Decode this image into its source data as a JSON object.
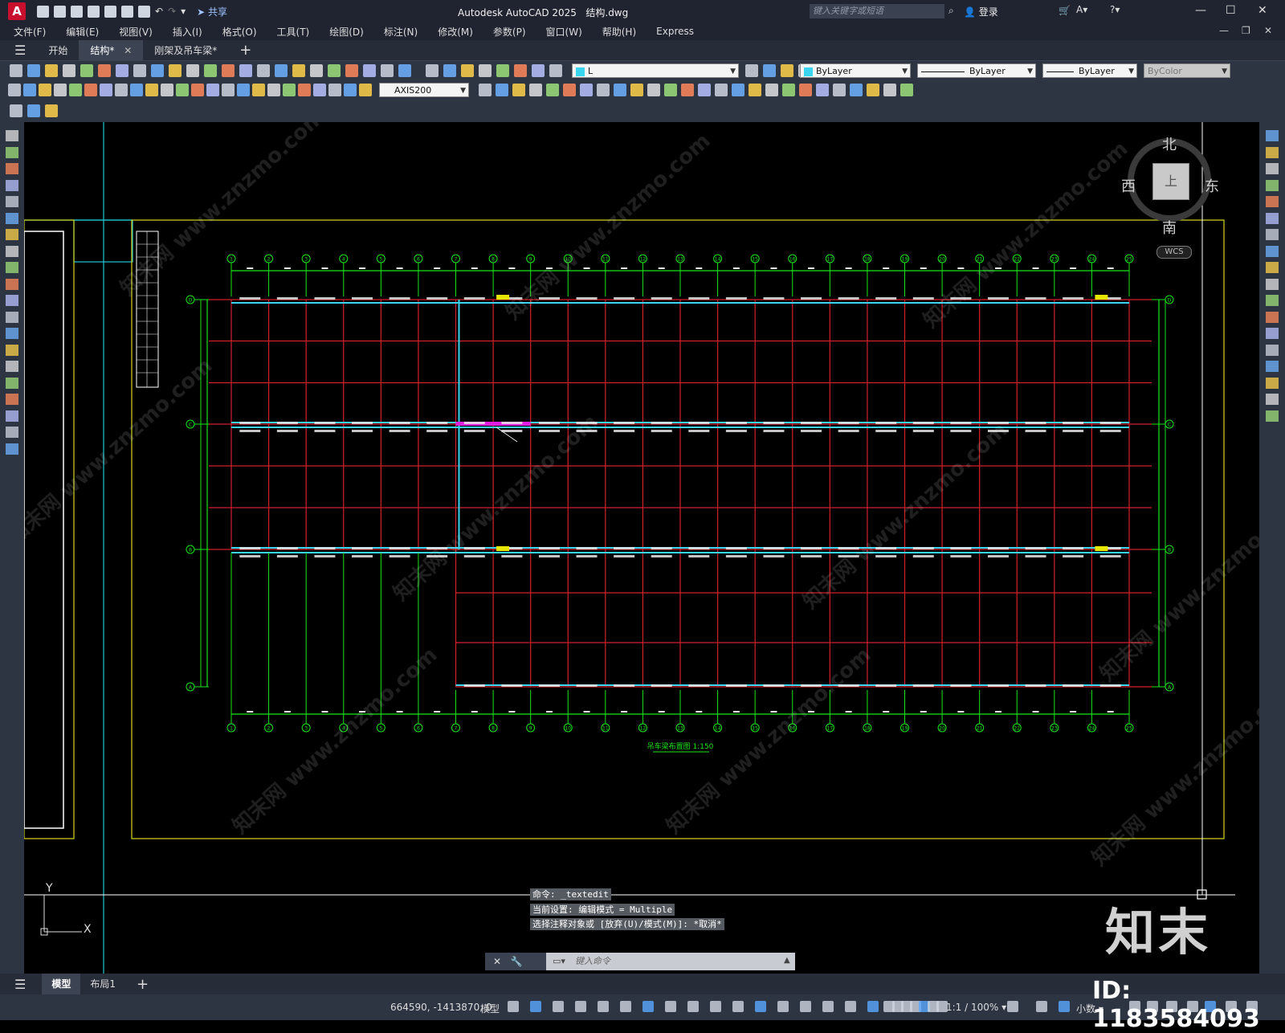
{
  "app": {
    "logo": "A",
    "title": "Autodesk AutoCAD 2025",
    "document": "结构.dwg",
    "share_label": "共享",
    "search_placeholder": "键入关键字或短语",
    "login_label": "登录"
  },
  "menu": [
    "文件(F)",
    "编辑(E)",
    "视图(V)",
    "插入(I)",
    "格式(O)",
    "工具(T)",
    "绘图(D)",
    "标注(N)",
    "修改(M)",
    "参数(P)",
    "窗口(W)",
    "帮助(H)",
    "Express"
  ],
  "doc_tabs": [
    "开始",
    "结构*",
    "刚架及吊车梁*"
  ],
  "toolbar": {
    "layer_name": "L",
    "color": "ByLayer",
    "linetype": "ByLayer",
    "lineweight": "ByLayer",
    "plotstyle": "ByColor",
    "dimstyle": "AXIS200"
  },
  "viewcube": {
    "north": "北",
    "south": "南",
    "east": "东",
    "west": "西",
    "face": "上",
    "wcs": "WCS"
  },
  "command_history": [
    "命令: _textedit",
    "当前设置: 编辑模式 = Multiple",
    "选择注释对象或 [放弃(U)/模式(M)]: *取消*"
  ],
  "command_placeholder": "键入命令",
  "drawing_title": "吊车梁布置图 1:150",
  "axis_labels_top": [
    "1",
    "2",
    "3",
    "4",
    "5",
    "6",
    "7",
    "8",
    "9",
    "10",
    "11",
    "12",
    "13",
    "14",
    "15",
    "16",
    "17",
    "18",
    "19",
    "20",
    "21",
    "22",
    "23",
    "24",
    "25"
  ],
  "axis_labels_side": [
    "D",
    "C",
    "B",
    "A"
  ],
  "ucs": {
    "x": "X",
    "y": "Y"
  },
  "layout_tabs": [
    "模型",
    "布局1"
  ],
  "status": {
    "coordinates": "664590, -1413870, 0",
    "mode": "模型",
    "scale": "1:1 / 100%",
    "units": "小数"
  },
  "watermark": {
    "brand": "知末",
    "id": "ID: 1183584093",
    "text": "知末网 www.znzmo.com"
  },
  "colors": {
    "grid_red": "#d4202a",
    "axis_green": "#19e619",
    "beam_cyan": "#3ad6f0",
    "frame_yellow": "#d6d620",
    "highlight_magenta": "#e020e0"
  }
}
